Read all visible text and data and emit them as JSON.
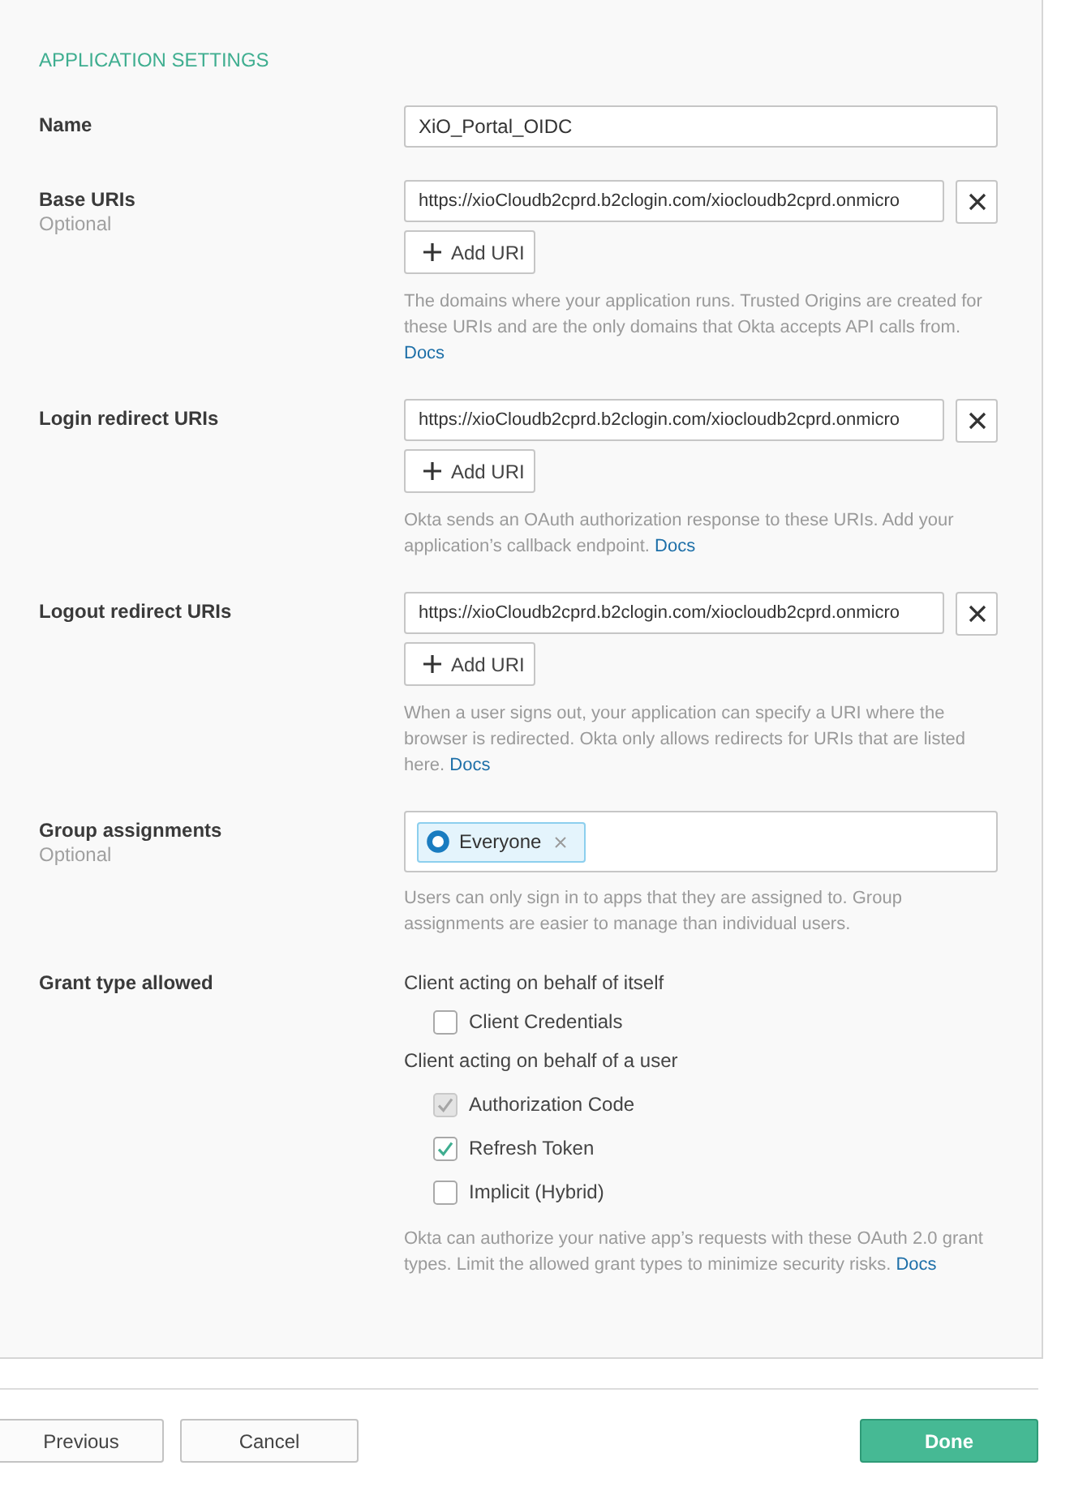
{
  "section": {
    "title": "APPLICATION SETTINGS"
  },
  "fields": [
    {
      "kind": "text",
      "label": "Name",
      "value": "XiO_Portal_OIDC"
    },
    {
      "kind": "uri_list",
      "label": "Base URIs",
      "note": "Optional",
      "uris": [
        "https://xioCloudb2cprd.b2clogin.com/xiocloudb2cprd.onmicro"
      ],
      "add_button": "Add URI",
      "help": "The domains where your application runs. Trusted Origins are created for these URIs and are the only domains that Okta accepts API calls from.",
      "help_link": "Docs"
    },
    {
      "kind": "uri_list",
      "label": "Login redirect URIs",
      "uris": [
        "https://xioCloudb2cprd.b2clogin.com/xiocloudb2cprd.onmicro"
      ],
      "add_button": "Add URI",
      "help": "Okta sends an OAuth authorization response to these URIs. Add your application’s callback endpoint.",
      "help_link": "Docs"
    },
    {
      "kind": "uri_list",
      "label": "Logout redirect URIs",
      "uris": [
        "https://xioCloudb2cprd.b2clogin.com/xiocloudb2cprd.onmicro"
      ],
      "add_button": "Add URI",
      "help": "When a user signs out, your application can specify a URI where the browser is redirected. Okta only allows redirects for URIs that are listed here.",
      "help_link": "Docs"
    },
    {
      "kind": "groups",
      "label": "Group assignments",
      "note": "Optional",
      "tags": [
        {
          "label": "Everyone"
        }
      ],
      "help": "Users can only sign in to apps that they are assigned to. Group assignments are easier to manage than individual users."
    },
    {
      "kind": "checkbox_groups",
      "label": "Grant type allowed",
      "groups": [
        {
          "heading": "Client acting on behalf of itself",
          "options": [
            {
              "label": "Client Credentials",
              "checked": false,
              "disabled": false
            }
          ]
        },
        {
          "heading": "Client acting on behalf of a user",
          "options": [
            {
              "label": "Authorization Code",
              "checked": true,
              "disabled": true
            },
            {
              "label": "Refresh Token",
              "checked": true,
              "disabled": false
            },
            {
              "label": "Implicit (Hybrid)",
              "checked": false,
              "disabled": false
            }
          ]
        }
      ],
      "help": "Okta can authorize your native app’s requests with these OAuth 2.0 grant types. Limit the allowed grant types to minimize security risks.",
      "help_link": "Docs"
    }
  ],
  "footer": {
    "buttons": [
      {
        "label": "Previous",
        "kind": "secondary"
      },
      {
        "label": "Cancel",
        "kind": "secondary"
      },
      {
        "label": "Done",
        "kind": "primary"
      }
    ]
  }
}
